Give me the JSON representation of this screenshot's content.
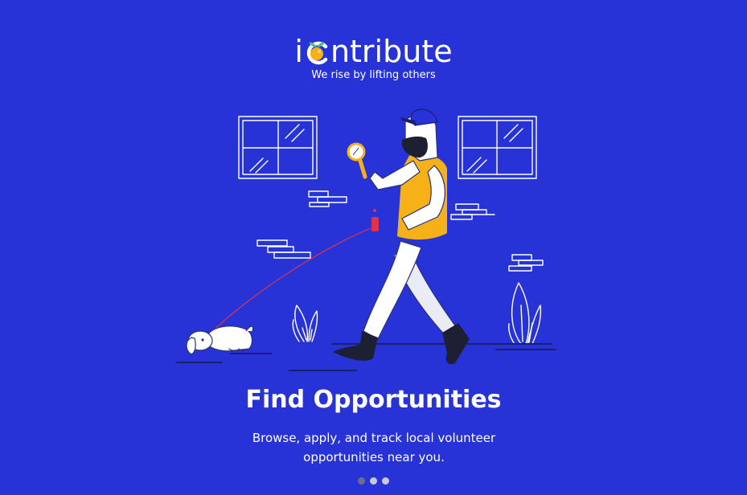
{
  "brand": {
    "name_prefix": "i",
    "name_suffix": "ntribute",
    "tagline": "We rise by lifting others",
    "colors": {
      "background": "#2733d6",
      "accent": "#f6b119",
      "leaf": "#4fc27a"
    }
  },
  "slide": {
    "title": "Find Opportunities",
    "description": "Browse, apply, and track local volunteer opportunities near you."
  },
  "pagination": {
    "total": 3,
    "active_index": 0
  },
  "illustration": {
    "icon": "volunteer-walking-dog-illustration"
  }
}
